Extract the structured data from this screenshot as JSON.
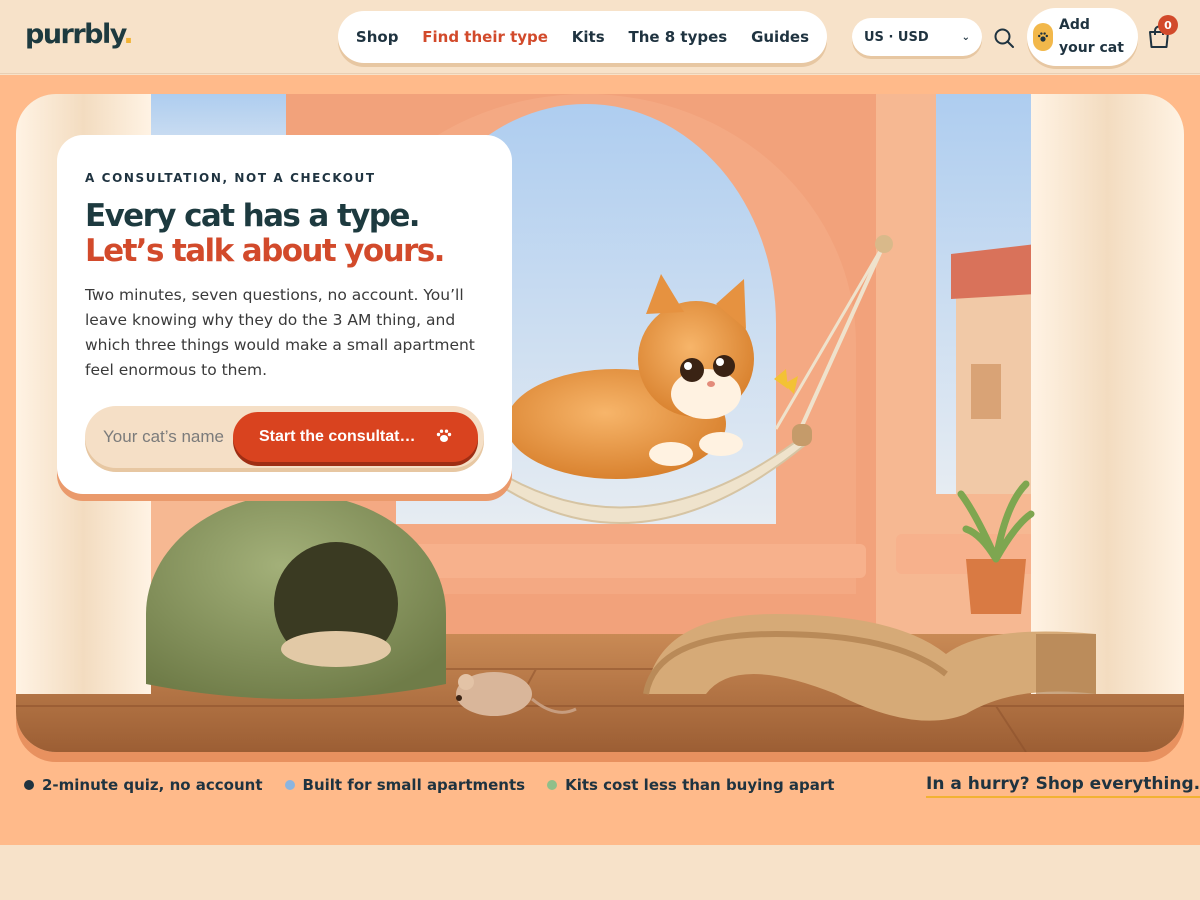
{
  "brand": {
    "name": "purrbly",
    "dot": ".",
    "accent": "#f2b233"
  },
  "nav": {
    "items": [
      "Shop",
      "Find their type",
      "Kits",
      "The 8 types",
      "Guides"
    ],
    "active": "Find their type"
  },
  "header": {
    "currency": "US · USD",
    "add_cat_label": "Add your cat",
    "cart_count": "0",
    "icons": {
      "search": "search-icon",
      "cart": "shopping-bag-icon",
      "paw": "paw-icon",
      "chevron": "chevron-down-icon"
    }
  },
  "hero": {
    "eyebrow": "A CONSULTATION, NOT A CHECKOUT",
    "headline_1": "Every cat has a type.",
    "headline_2": "Let’s talk about yours.",
    "body": "Two minutes, seven questions, no account. You’ll leave knowing why they do the 3 AM thing, and which three things would make a small apartment feel enormous to them.",
    "input_placeholder": "Your cat’s name",
    "cta_label": "Start the consultat…",
    "image_alt": "Orange kitten in a window hammock, felt cat cave, wave scratcher and toy mouse"
  },
  "features": [
    {
      "label": "2-minute quiz, no account",
      "color": "#1f3340"
    },
    {
      "label": "Built for small apartments",
      "color": "#8bb5e0"
    },
    {
      "label": "Kits cost less than buying apart",
      "color": "#8fbf8a"
    }
  ],
  "hurry_link": "In a hurry? Shop everything.",
  "colors": {
    "primary": "#d24a2b",
    "navy": "#1f3340",
    "cream": "#f7e2c9",
    "peach": "#ffba8a"
  }
}
